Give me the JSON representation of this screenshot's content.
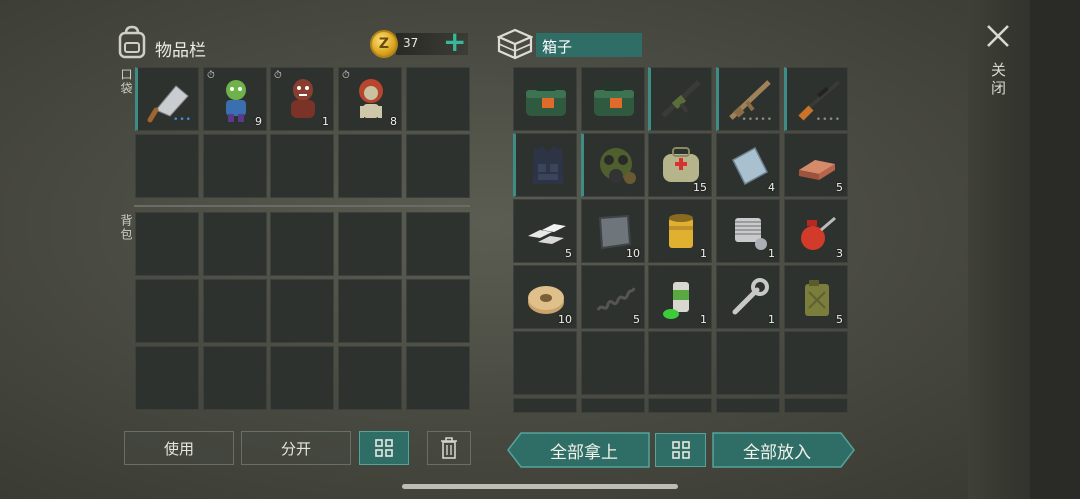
{
  "inventory": {
    "title": "物品栏",
    "coins": "37",
    "coin_symbol": "Z",
    "pocket_label": "口袋",
    "backpack_label": "背包",
    "pocket_items": [
      {
        "name": "cleaver-icon",
        "qty": "",
        "dots": "•••",
        "dot_color": "#4a8fd6",
        "timer": false
      },
      {
        "name": "green-zombie-toy-icon",
        "qty": "9",
        "timer": true
      },
      {
        "name": "brown-zombie-toy-icon",
        "qty": "1",
        "timer": true
      },
      {
        "name": "redhair-zombie-toy-icon",
        "qty": "8",
        "timer": true
      }
    ]
  },
  "container": {
    "title": "箱子",
    "items": [
      {
        "name": "ammo-bag-icon",
        "qty": ""
      },
      {
        "name": "ammo-bag-icon",
        "qty": ""
      },
      {
        "name": "assault-rifle-icon",
        "qty": ""
      },
      {
        "name": "scar-rifle-icon",
        "qty": "",
        "dots": "•••••",
        "dot_color": "#8a8a82"
      },
      {
        "name": "sniper-rifle-icon",
        "qty": "",
        "dots": "••••",
        "dot_color": "#8a8a82"
      },
      {
        "name": "tactical-vest-icon",
        "qty": ""
      },
      {
        "name": "gas-mask-icon",
        "qty": ""
      },
      {
        "name": "medkit-bag-icon",
        "qty": "15"
      },
      {
        "name": "steel-plate-icon",
        "qty": "4"
      },
      {
        "name": "copper-ingot-icon",
        "qty": "5"
      },
      {
        "name": "aluminum-bars-icon",
        "qty": "5"
      },
      {
        "name": "metal-plate-icon",
        "qty": "10"
      },
      {
        "name": "oil-filter-icon",
        "qty": "1"
      },
      {
        "name": "engine-cylinder-icon",
        "qty": "1"
      },
      {
        "name": "oil-can-icon",
        "qty": "3"
      },
      {
        "name": "wire-spool-icon",
        "qty": "10"
      },
      {
        "name": "spring-icon",
        "qty": "5"
      },
      {
        "name": "spray-can-icon",
        "qty": "1"
      },
      {
        "name": "wrench-icon",
        "qty": "1"
      },
      {
        "name": "jerry-can-icon",
        "qty": "5"
      }
    ]
  },
  "buttons": {
    "use": "使用",
    "split": "分开",
    "take_all": "全部拿上",
    "put_all": "全部放入",
    "close": "关闭"
  },
  "colors": {
    "accent": "#2f6e67",
    "accent_bright": "#38b89b"
  }
}
